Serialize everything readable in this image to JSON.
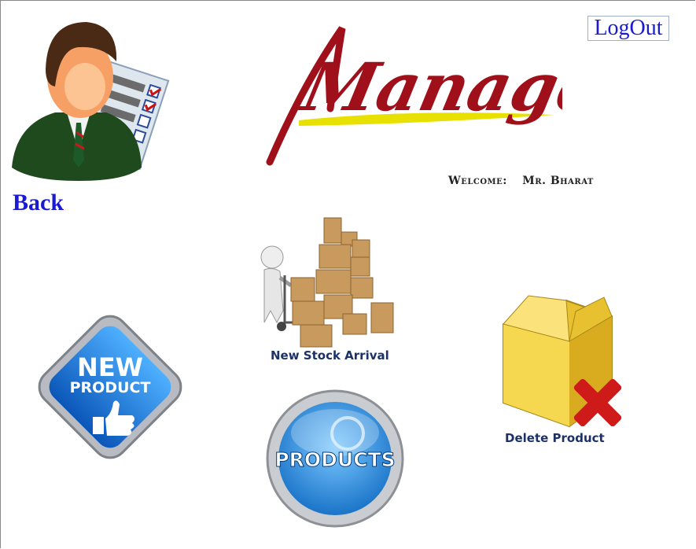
{
  "header": {
    "logo_text": "Manager",
    "logout_label": "LogOut",
    "back_label": "Back",
    "welcome_label": "Welcome:",
    "welcome_user": "Mr. Bharat"
  },
  "tiles": {
    "new_stock_label": "New Stock Arrival",
    "new_product_line1": "NEW",
    "new_product_line2": "PRODUCT",
    "products_label": "PRODUCTS",
    "delete_product_label": "Delete Product"
  },
  "colors": {
    "link": "#1a1ad6",
    "logo_red": "#a0101a",
    "logo_swoosh": "#e8e000",
    "caption": "#1c3166"
  }
}
